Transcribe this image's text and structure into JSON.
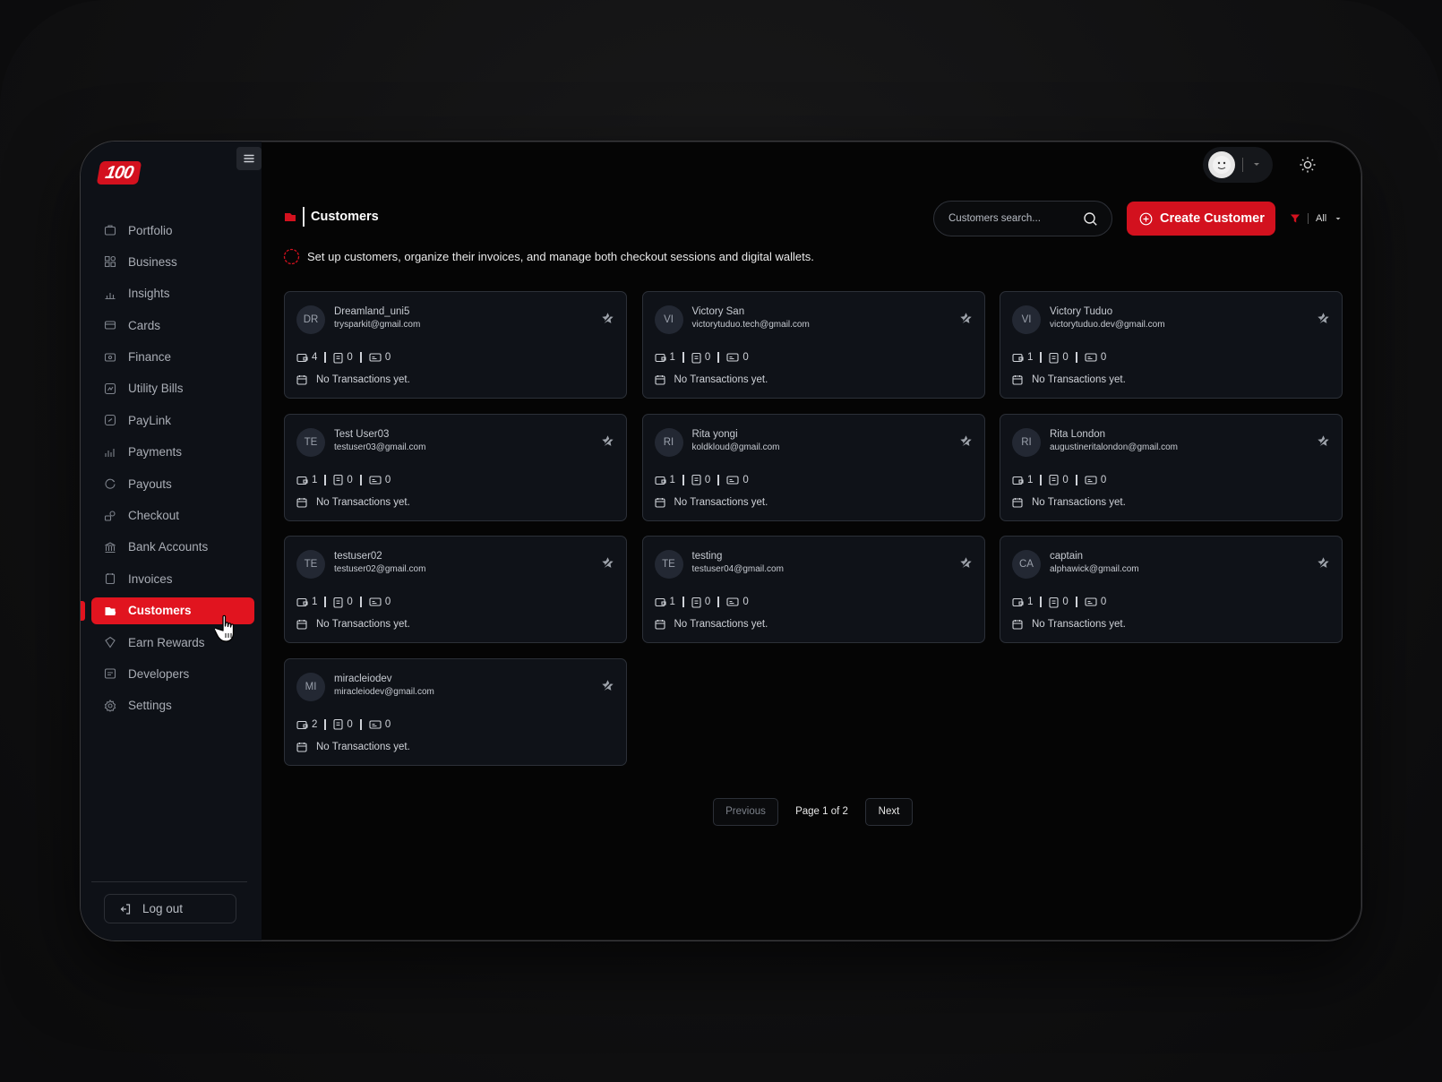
{
  "app": {
    "logo_text": "100",
    "brand_color": "#d3111e"
  },
  "sidebar": {
    "items": [
      {
        "label": "Portfolio",
        "icon": "portfolio-icon"
      },
      {
        "label": "Business",
        "icon": "business-icon"
      },
      {
        "label": "Insights",
        "icon": "insights-icon"
      },
      {
        "label": "Cards",
        "icon": "cards-icon"
      },
      {
        "label": "Finance",
        "icon": "finance-icon"
      },
      {
        "label": "Utility Bills",
        "icon": "utility-bills-icon"
      },
      {
        "label": "PayLink",
        "icon": "paylink-icon"
      },
      {
        "label": "Payments",
        "icon": "payments-icon"
      },
      {
        "label": "Payouts",
        "icon": "payouts-icon"
      },
      {
        "label": "Checkout",
        "icon": "checkout-icon"
      },
      {
        "label": "Bank Accounts",
        "icon": "bank-icon"
      },
      {
        "label": "Invoices",
        "icon": "invoices-icon"
      },
      {
        "label": "Customers",
        "icon": "customers-icon",
        "active": true
      },
      {
        "label": "Earn Rewards",
        "icon": "rewards-icon"
      },
      {
        "label": "Developers",
        "icon": "developers-icon"
      },
      {
        "label": "Settings",
        "icon": "settings-icon"
      }
    ],
    "logout_label": "Log out"
  },
  "header": {
    "title": "Customers",
    "search_placeholder": "Customers search...",
    "create_label": "Create Customer",
    "filter_value": "All"
  },
  "notice": "Set up customers, organize their invoices, and manage both checkout sessions and digital wallets.",
  "customers": [
    {
      "initials": "DR",
      "name": "Dreamland_uni5",
      "email": "trysparkit@gmail.com",
      "wallets": "4",
      "invoices": "0",
      "checkouts": "0",
      "tx": "No Transactions yet."
    },
    {
      "initials": "VI",
      "name": "Victory San",
      "email": "victorytuduo.tech@gmail.com",
      "wallets": "1",
      "invoices": "0",
      "checkouts": "0",
      "tx": "No Transactions yet."
    },
    {
      "initials": "VI",
      "name": "Victory Tuduo",
      "email": "victorytuduo.dev@gmail.com",
      "wallets": "1",
      "invoices": "0",
      "checkouts": "0",
      "tx": "No Transactions yet."
    },
    {
      "initials": "TE",
      "name": "Test User03",
      "email": "testuser03@gmail.com",
      "wallets": "1",
      "invoices": "0",
      "checkouts": "0",
      "tx": "No Transactions yet."
    },
    {
      "initials": "RI",
      "name": "Rita yongi",
      "email": "koldkloud@gmail.com",
      "wallets": "1",
      "invoices": "0",
      "checkouts": "0",
      "tx": "No Transactions yet."
    },
    {
      "initials": "RI",
      "name": "Rita London",
      "email": "augustineritalondon@gmail.com",
      "wallets": "1",
      "invoices": "0",
      "checkouts": "0",
      "tx": "No Transactions yet."
    },
    {
      "initials": "TE",
      "name": "testuser02",
      "email": "testuser02@gmail.com",
      "wallets": "1",
      "invoices": "0",
      "checkouts": "0",
      "tx": "No Transactions yet."
    },
    {
      "initials": "TE",
      "name": "testing",
      "email": "testuser04@gmail.com",
      "wallets": "1",
      "invoices": "0",
      "checkouts": "0",
      "tx": "No Transactions yet."
    },
    {
      "initials": "CA",
      "name": "captain",
      "email": "alphawick@gmail.com",
      "wallets": "1",
      "invoices": "0",
      "checkouts": "0",
      "tx": "No Transactions yet."
    },
    {
      "initials": "MI",
      "name": "miracleiodev",
      "email": "miracleiodev@gmail.com",
      "wallets": "2",
      "invoices": "0",
      "checkouts": "0",
      "tx": "No Transactions yet."
    }
  ],
  "pagination": {
    "previous": "Previous",
    "label": "Page 1 of 2",
    "next": "Next"
  }
}
